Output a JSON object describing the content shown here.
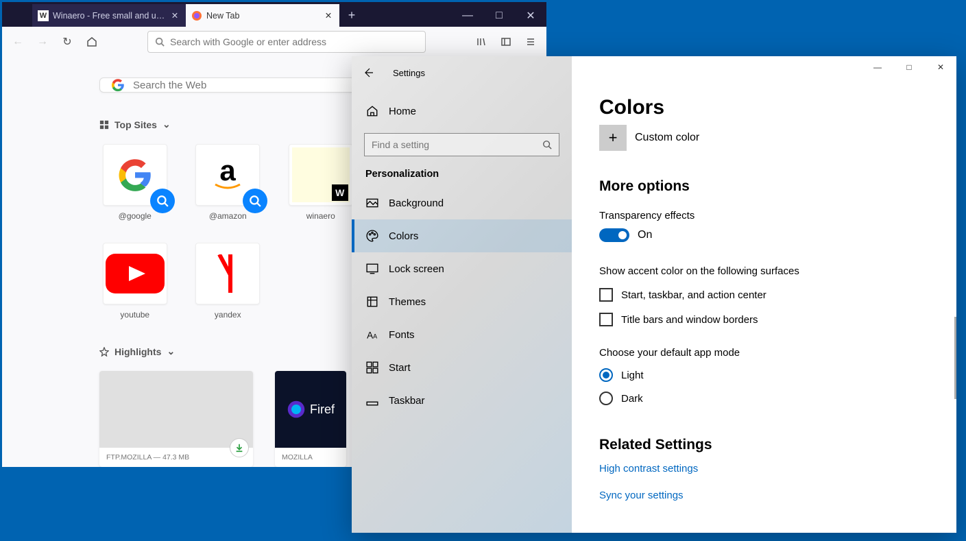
{
  "firefox": {
    "tabs": [
      {
        "title": "Winaero - Free small and usefu",
        "active": false
      },
      {
        "title": "New Tab",
        "active": true
      }
    ],
    "url_placeholder": "Search with Google or enter address",
    "search_placeholder": "Search the Web",
    "top_sites_label": "Top Sites",
    "sites": [
      {
        "label": "@google"
      },
      {
        "label": "@amazon"
      },
      {
        "label": "winaero"
      },
      {
        "label": "youtube"
      },
      {
        "label": "yandex"
      }
    ],
    "highlights_label": "Highlights",
    "highlights": [
      {
        "title": "FTP.MOZILLA — 47.3 MB"
      },
      {
        "title": "MOZILLA"
      }
    ],
    "firefox_tile_text": "Firef"
  },
  "settings": {
    "back_title": "Settings",
    "home": "Home",
    "search_placeholder": "Find a setting",
    "category": "Personalization",
    "items": [
      {
        "label": "Background"
      },
      {
        "label": "Colors"
      },
      {
        "label": "Lock screen"
      },
      {
        "label": "Themes"
      },
      {
        "label": "Fonts"
      },
      {
        "label": "Start"
      },
      {
        "label": "Taskbar"
      }
    ],
    "main": {
      "heading": "Colors",
      "custom_color": "Custom color",
      "more_options": "More options",
      "transparency": "Transparency effects",
      "transparency_state": "On",
      "accent_surfaces": "Show accent color on the following surfaces",
      "chk_start": "Start, taskbar, and action center",
      "chk_title": "Title bars and window borders",
      "app_mode": "Choose your default app mode",
      "radio_light": "Light",
      "radio_dark": "Dark",
      "related": "Related Settings",
      "link_contrast": "High contrast settings",
      "link_sync": "Sync your settings"
    }
  }
}
